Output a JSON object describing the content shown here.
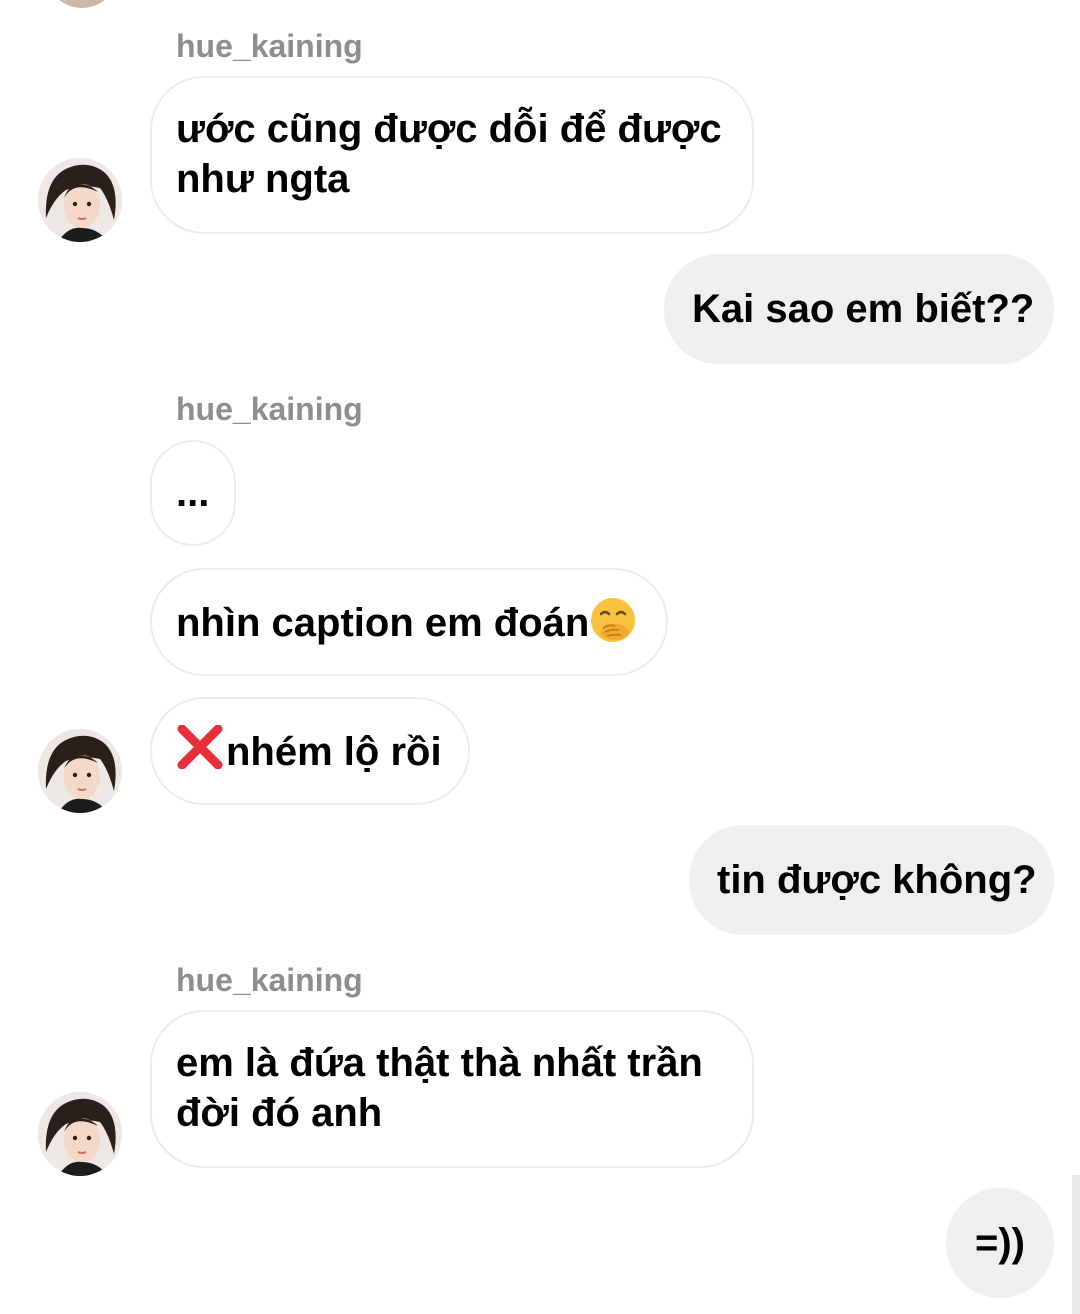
{
  "conversation": {
    "messages": [
      {
        "id": "m1",
        "direction": "incoming",
        "sender": "hue_kaining",
        "lines": [
          "ước cũng được dỗi để được",
          "như ngta"
        ]
      },
      {
        "id": "m2",
        "direction": "outgoing",
        "lines": [
          "Kai sao em biết??"
        ]
      },
      {
        "id": "m3",
        "direction": "incoming",
        "sender": "hue_kaining",
        "lines": [
          "..."
        ]
      },
      {
        "id": "m4",
        "direction": "incoming",
        "lines": [
          "nhìn caption em đoán"
        ],
        "trailing_emoji": "face-with-hand-over-mouth-icon"
      },
      {
        "id": "m5",
        "direction": "incoming",
        "lines": [
          "nhém lộ rồi"
        ],
        "leading_emoji": "cross-mark-icon"
      },
      {
        "id": "m6",
        "direction": "outgoing",
        "lines": [
          "tin được không?"
        ]
      },
      {
        "id": "m7",
        "direction": "incoming",
        "sender": "hue_kaining",
        "lines": [
          "em là đứa thật thà nhất trần",
          "đời đó anh"
        ]
      },
      {
        "id": "m8",
        "direction": "outgoing",
        "lines": [
          "=))"
        ]
      }
    ]
  },
  "colors": {
    "incoming_bubble_border": "#ececec",
    "outgoing_bubble_bg": "#efefef",
    "sender_name": "#8e8e8e",
    "text": "#000000",
    "cross_mark": "#e8303a",
    "emoji_face": "#f7c23d"
  }
}
